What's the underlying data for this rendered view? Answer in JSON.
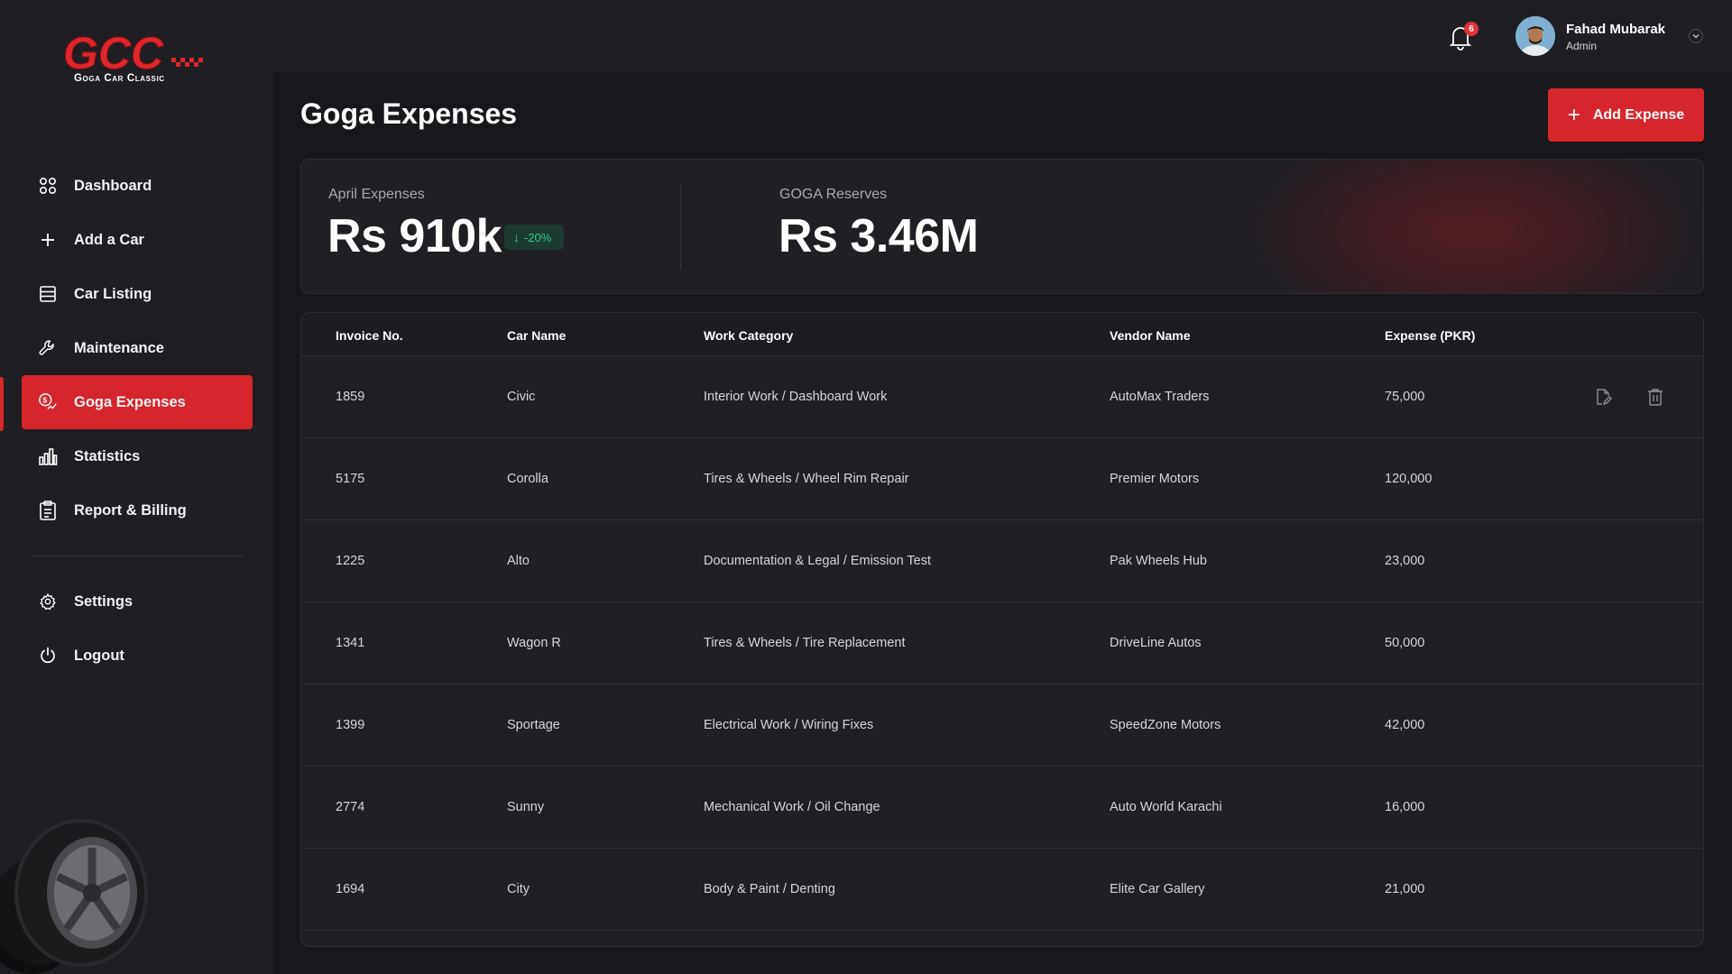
{
  "brand": {
    "logo_text": "GCC",
    "logo_subtitle": "Goga Car Classic",
    "accent": "#d7262b"
  },
  "sidebar": {
    "items": [
      {
        "label": "Dashboard",
        "icon": "grid-icon"
      },
      {
        "label": "Add a Car",
        "icon": "plus-icon"
      },
      {
        "label": "Car Listing",
        "icon": "list-icon"
      },
      {
        "label": "Maintenance",
        "icon": "wrench-icon"
      },
      {
        "label": "Goga Expenses",
        "icon": "expenses-icon",
        "active": true
      },
      {
        "label": "Statistics",
        "icon": "bar-chart-icon"
      },
      {
        "label": "Report & Billing",
        "icon": "clipboard-icon"
      }
    ],
    "bottom_items": [
      {
        "label": "Settings",
        "icon": "gear-icon"
      },
      {
        "label": "Logout",
        "icon": "power-icon"
      }
    ]
  },
  "topbar": {
    "notifications": {
      "count": "6",
      "icon": "bell-icon"
    },
    "user": {
      "name": "Fahad Mubarak",
      "role": "Admin"
    }
  },
  "page": {
    "title": "Goga Expenses",
    "add_button": "Add Expense"
  },
  "stats": {
    "april": {
      "label": "April Expenses",
      "value": "Rs 910k",
      "trend": "-20%",
      "trend_color": "#2fcf8a"
    },
    "reserves": {
      "label": "GOGA Reserves",
      "value": "Rs 3.46M"
    }
  },
  "table": {
    "columns": [
      "Invoice No.",
      "Car Name",
      "Work Category",
      "Vendor Name",
      "Expense (PKR)"
    ],
    "rows": [
      [
        "1859",
        "Civic",
        "Interior Work / Dashboard Work",
        "AutoMax Traders",
        "75,000"
      ],
      [
        "5175",
        "Corolla",
        "Tires & Wheels / Wheel Rim Repair",
        "Premier Motors",
        "120,000"
      ],
      [
        "1225",
        "Alto",
        "Documentation & Legal / Emission Test",
        "Pak Wheels Hub",
        "23,000"
      ],
      [
        "1341",
        "Wagon R",
        "Tires & Wheels / Tire Replacement",
        "DriveLine Autos",
        "50,000"
      ],
      [
        "1399",
        "Sportage",
        "Electrical Work / Wiring Fixes",
        "SpeedZone Motors",
        "42,000"
      ],
      [
        "2774",
        "Sunny",
        "Mechanical Work / Oil Change",
        "Auto World Karachi",
        "16,000"
      ],
      [
        "1694",
        "City",
        "Body & Paint / Denting",
        "Elite Car Gallery",
        "21,000"
      ]
    ]
  }
}
